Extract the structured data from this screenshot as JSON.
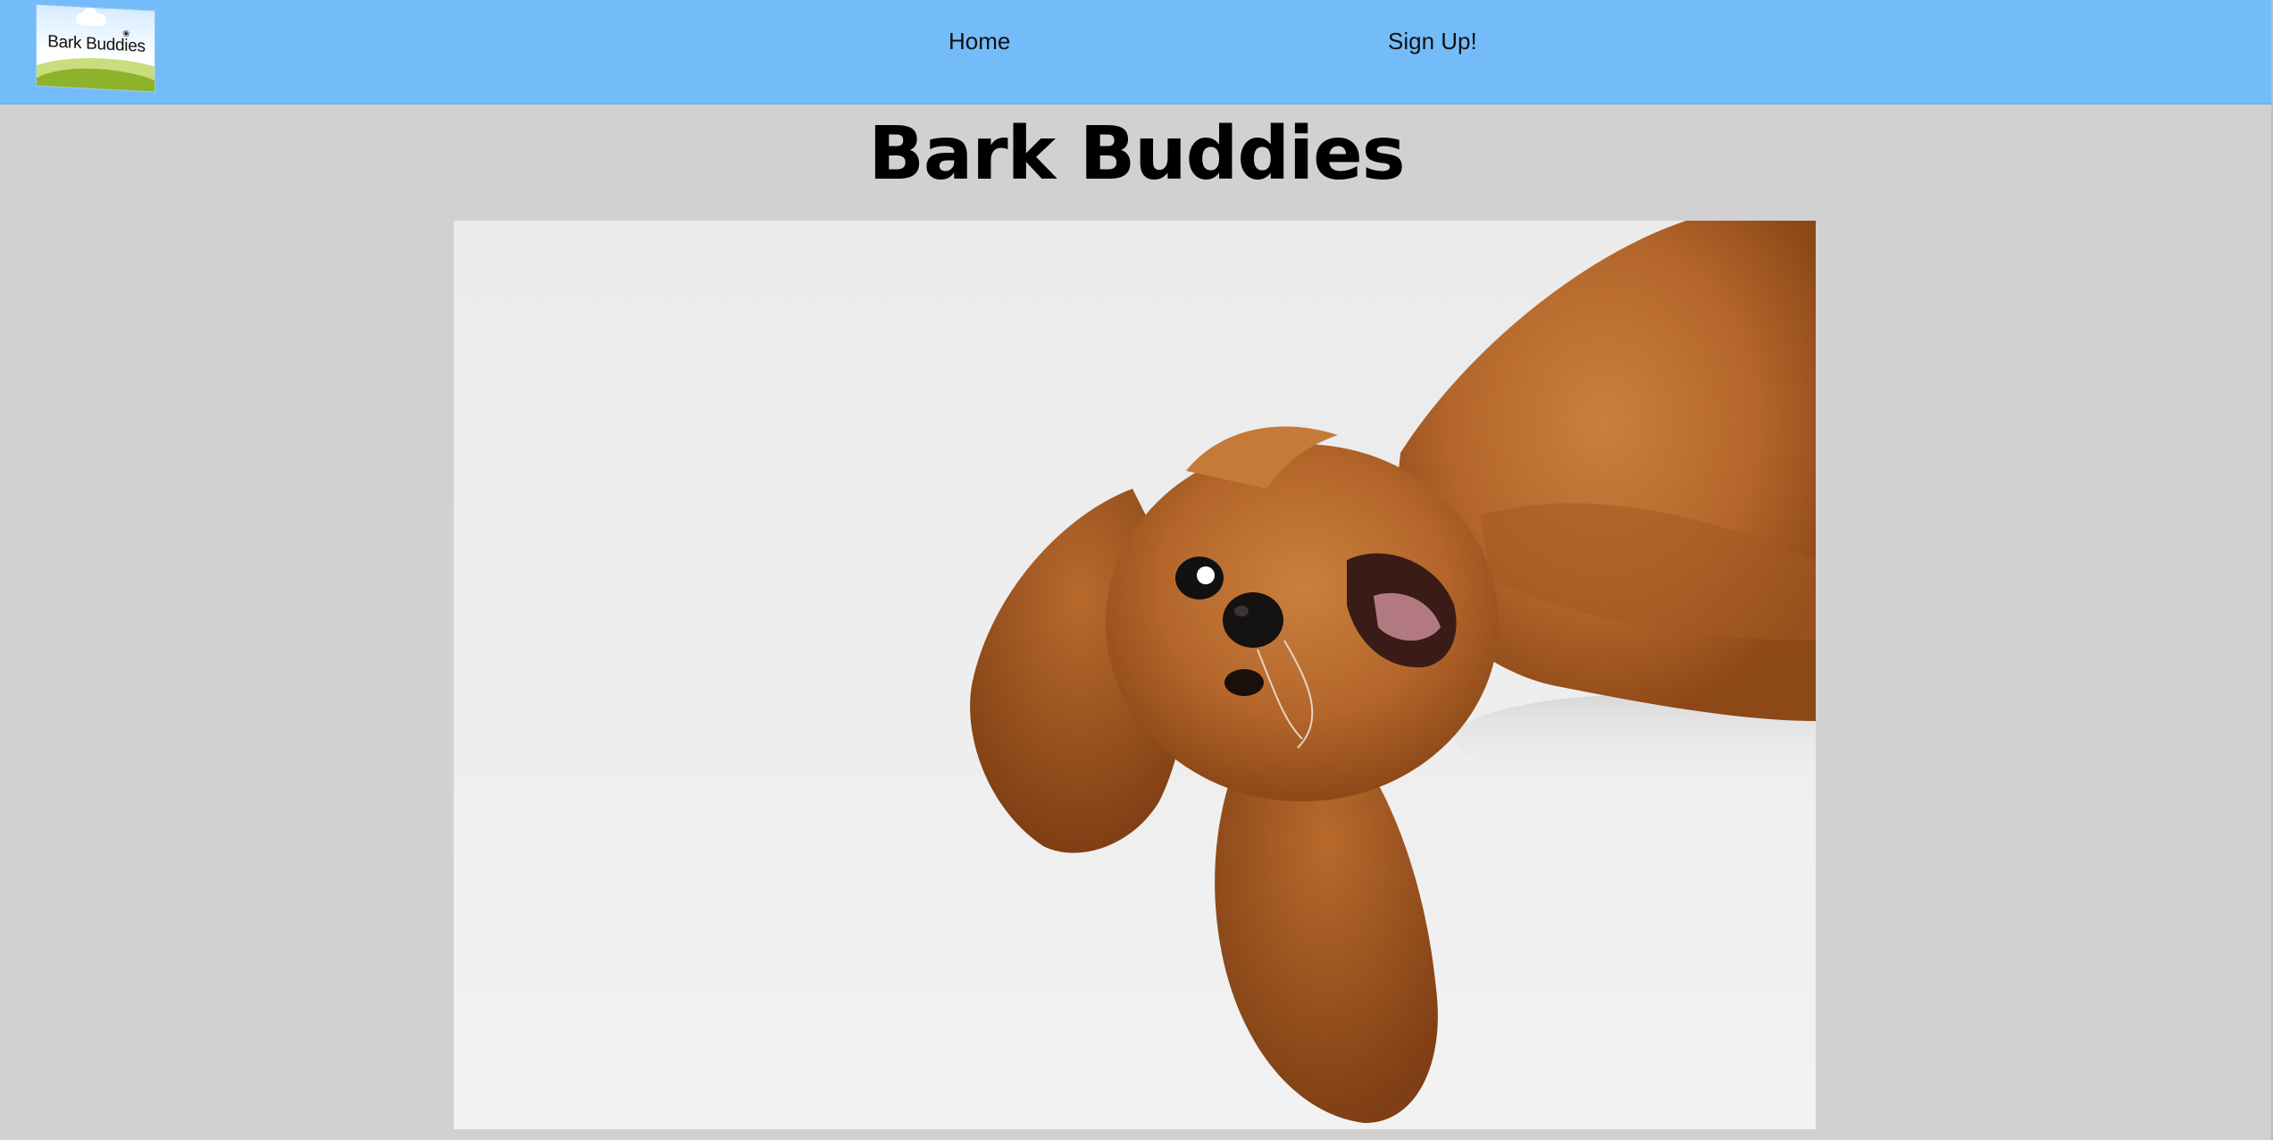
{
  "header": {
    "logo_text": "Bark Buddies",
    "nav": [
      {
        "label": "Home"
      },
      {
        "label": "Sign Up!"
      }
    ],
    "background_color": "#74bcf9"
  },
  "main": {
    "title": "Bark Buddies",
    "hero_image": {
      "alt": "Cocker spaniel puppy upside down"
    }
  },
  "colors": {
    "page_background": "#d1d1d1",
    "dog_fur": "#b8682a"
  }
}
